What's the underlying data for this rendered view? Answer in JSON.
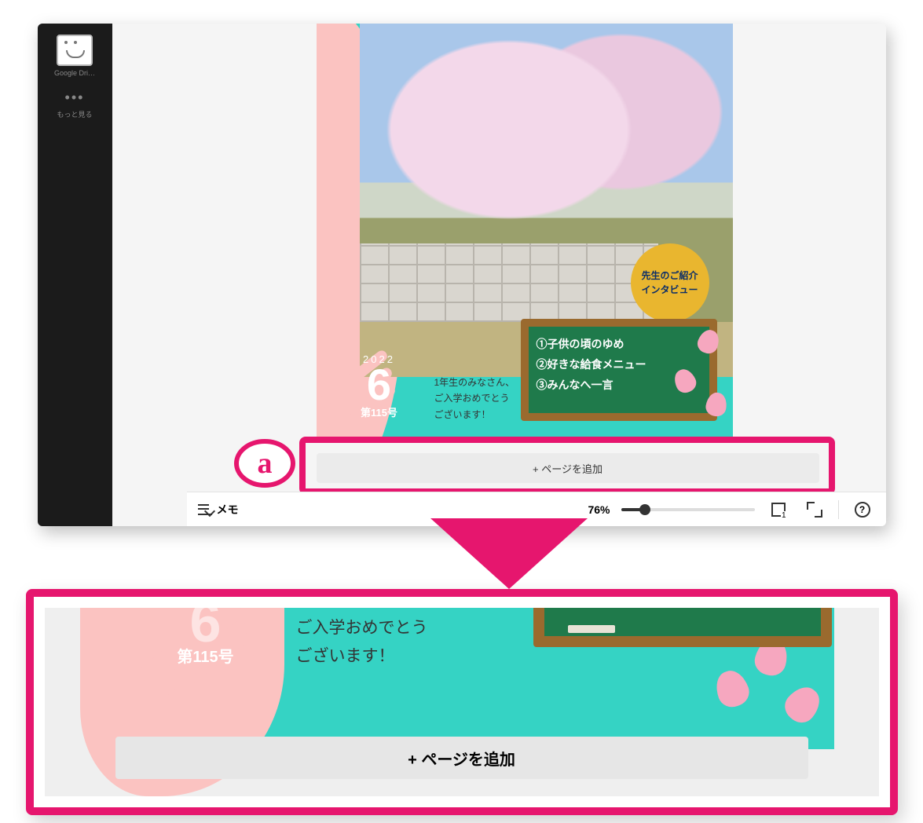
{
  "sidebar": {
    "drive_label": "Google Dri…",
    "more_label": "もっと見る"
  },
  "design": {
    "year": "2022",
    "month": "6",
    "issue": "第115号",
    "greeting_1": "1年生のみなさん、",
    "greeting_2": "ご入学おめでとう",
    "greeting_3": "ございます！",
    "badge_l1": "先生のご紹介",
    "badge_l2": "インタビュー",
    "board_1": "①子供の頃のゆめ",
    "board_2": "②好きな給食メニュー",
    "board_3": "③みんなへ一言"
  },
  "controls": {
    "add_page": "+ ページを追加",
    "memo": "メモ",
    "zoom_pct": "76%",
    "page_indicator": "1"
  },
  "annotation": {
    "a": "a"
  },
  "zoom": {
    "issue": "第115号",
    "greeting_2": "ご入学おめでとう",
    "greeting_3": "ございます！",
    "add_page": "+ ページを追加"
  }
}
